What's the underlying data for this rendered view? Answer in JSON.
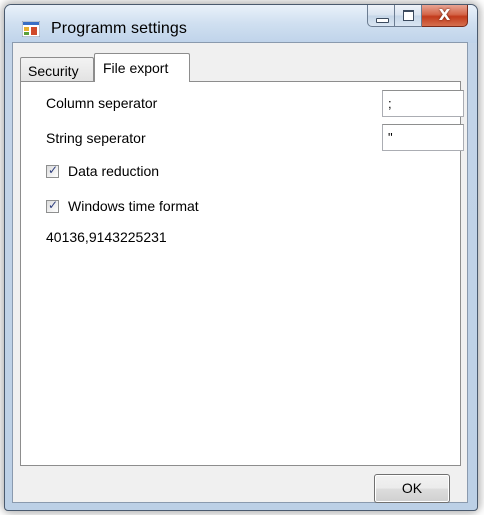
{
  "window": {
    "title": "Programm settings",
    "app_icon": "app-window-icon",
    "minimize_icon": "minimize-icon",
    "maximize_icon": "maximize-icon",
    "close_icon": "close-icon",
    "close_glyph": "X"
  },
  "tabs": [
    {
      "label": "Security",
      "selected": false
    },
    {
      "label": "File export",
      "selected": true
    }
  ],
  "file_export": {
    "column_separator_label": "Column seperator",
    "column_separator_value": ";",
    "string_separator_label": "String seperator",
    "string_separator_value": "\"",
    "data_reduction_label": "Data reduction",
    "data_reduction_checked": true,
    "windows_time_label": "Windows time format",
    "windows_time_checked": true,
    "time_value": "40136,9143225231"
  },
  "buttons": {
    "ok_label": "OK"
  },
  "colors": {
    "frame": "#bcd0e6",
    "close_button": "#c23b1c",
    "panel": "#ffffff",
    "dialog_background": "#f0f0f0"
  }
}
